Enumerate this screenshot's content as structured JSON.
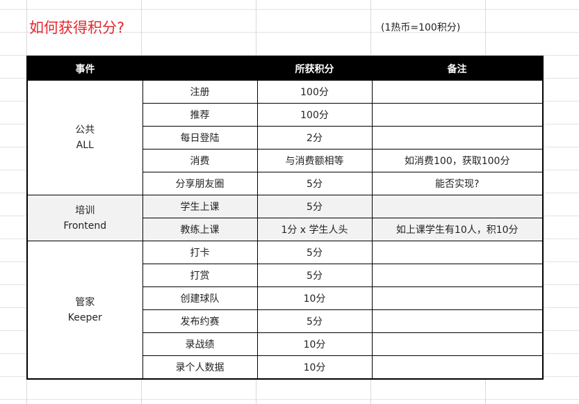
{
  "title": "如何获得积分?",
  "note": "(1热币=100积分)",
  "table": {
    "headers": [
      "事件",
      "",
      "所获积分",
      "备注"
    ],
    "groups": [
      {
        "name": "公共",
        "name_en": "ALL",
        "shaded": false,
        "rows": [
          {
            "event": "注册",
            "points": "100分",
            "remark": ""
          },
          {
            "event": "推荐",
            "points": "100分",
            "remark": ""
          },
          {
            "event": "每日登陆",
            "points": "2分",
            "remark": ""
          },
          {
            "event": "消费",
            "points": "与消费额相等",
            "remark": "如消费100，获取100分"
          },
          {
            "event": "分享朋友圈",
            "points": "5分",
            "remark": "能否实现?"
          }
        ]
      },
      {
        "name": "培训",
        "name_en": "Frontend",
        "shaded": true,
        "rows": [
          {
            "event": "学生上课",
            "points": "5分",
            "remark": ""
          },
          {
            "event": "教练上课",
            "points": "1分 x 学生人头",
            "remark": "如上课学生有10人，积10分"
          }
        ]
      },
      {
        "name": "管家",
        "name_en": "Keeper",
        "shaded": false,
        "rows": [
          {
            "event": "打卡",
            "points": "5分",
            "remark": ""
          },
          {
            "event": "打赏",
            "points": "5分",
            "remark": ""
          },
          {
            "event": "创建球队",
            "points": "10分",
            "remark": ""
          },
          {
            "event": "发布约赛",
            "points": "5分",
            "remark": ""
          },
          {
            "event": "录战绩",
            "points": "10分",
            "remark": ""
          },
          {
            "event": "录个人数据",
            "points": "10分",
            "remark": ""
          }
        ]
      }
    ]
  }
}
